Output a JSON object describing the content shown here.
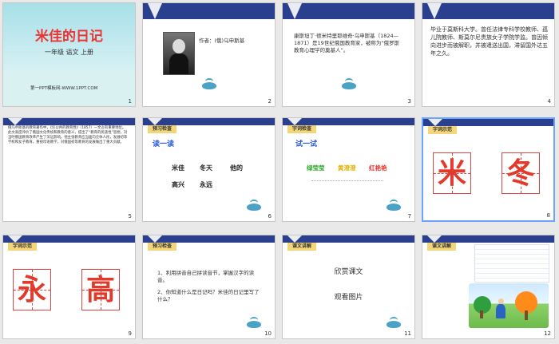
{
  "slides": [
    {
      "num": "1",
      "title": "米佳的日记",
      "subtitle": "一年级   语文   上册",
      "footer": "第一PPT模板网-WWW.1PPT.COM"
    },
    {
      "num": "2",
      "author": "作者：(俄)乌申斯基"
    },
    {
      "num": "3",
      "text": "康斯坦丁·德米特里耶维奇·乌申斯基（1824—1871）是19世纪俄国教育家，被称为“俄罗斯教育心理学的奠基人”。"
    },
    {
      "num": "4",
      "text": "毕业于莫斯科大学。曾任法律专科学校教师、孤儿院教师、斯莫尔尼贵族女子学院学监。曾因倾向进步而被解职，并被遣送出国，滞留国外达五年之久。"
    },
    {
      "num": "5",
      "text": "俄乌申斯基的教育著作中，《论公共的教育性》（1857）一文占有重要地位。此文高度评价了俄国文化传统和教育的意义，提出了“教育的民族性”思想，对当时俄国教育改革产生了深远影响。他主张教育应当面向全体人民，发展初等学校和女子教育，重视母语教学，对俄国初等教育的发展做出了重大贡献。"
    },
    {
      "num": "6",
      "ribbon": "预习检查",
      "head": "读一读",
      "words": [
        "米佳",
        "冬天",
        "他的",
        "高兴",
        "永远"
      ]
    },
    {
      "num": "7",
      "ribbon": "字词检查",
      "head": "试一试",
      "words": [
        "绿莹莹",
        "黄澄澄",
        "红艳艳"
      ]
    },
    {
      "num": "8",
      "ribbon": "字词示范",
      "chars": [
        "米",
        "冬"
      ]
    },
    {
      "num": "9",
      "ribbon": "字词示范",
      "chars": [
        "永",
        "高"
      ]
    },
    {
      "num": "10",
      "ribbon": "预习检查",
      "q1": "1、利用拼音自己拼读音节，掌握汉字的读音。",
      "q2": "2、你知道什么是日记吗？米佳的日记里写了什么？"
    },
    {
      "num": "11",
      "ribbon": "课文讲解",
      "l1": "欣赏课文",
      "l2": "观看图片"
    },
    {
      "num": "12",
      "ribbon": "课文讲解"
    }
  ]
}
